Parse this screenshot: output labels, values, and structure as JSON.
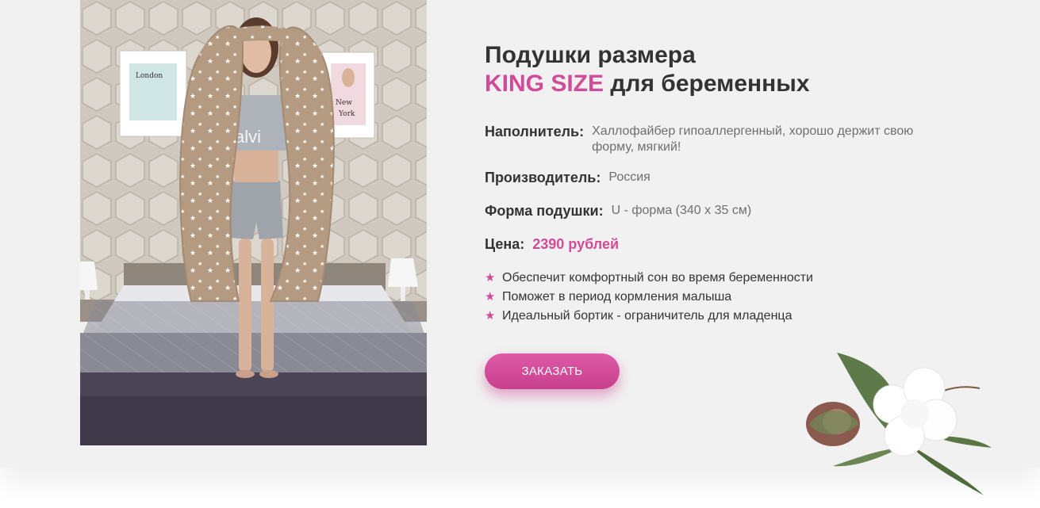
{
  "title": {
    "line1": "Подушки размера",
    "accent": "KING SIZE",
    "line2_rest": " для беременных"
  },
  "specs": {
    "filler_label": "Наполнитель:",
    "filler_value": "Халлофайбер гипоаллергенный, хорошо держит свою форму, мягкий!",
    "maker_label": "Производитель:",
    "maker_value": "Россия",
    "shape_label": "Форма подушки:",
    "shape_value": "U - форма (340 х 35 см)",
    "price_label": "Цена:",
    "price_value": "2390 рублей"
  },
  "bullets": [
    "Обеспечит комфортный сон во время беременности",
    "Поможет в период кормления малыша",
    "Идеальный бортик - ограничитель для младенца"
  ],
  "order_button": "ЗАКАЗАТЬ",
  "photo_wall_texts": {
    "left_poster": "London",
    "right_poster_1": "New",
    "right_poster_2": "York",
    "shirt": "alvi"
  },
  "colors": {
    "accent": "#d14c98",
    "heading": "#333333",
    "muted": "#6e6e6e",
    "background": "#f1f1f1"
  }
}
